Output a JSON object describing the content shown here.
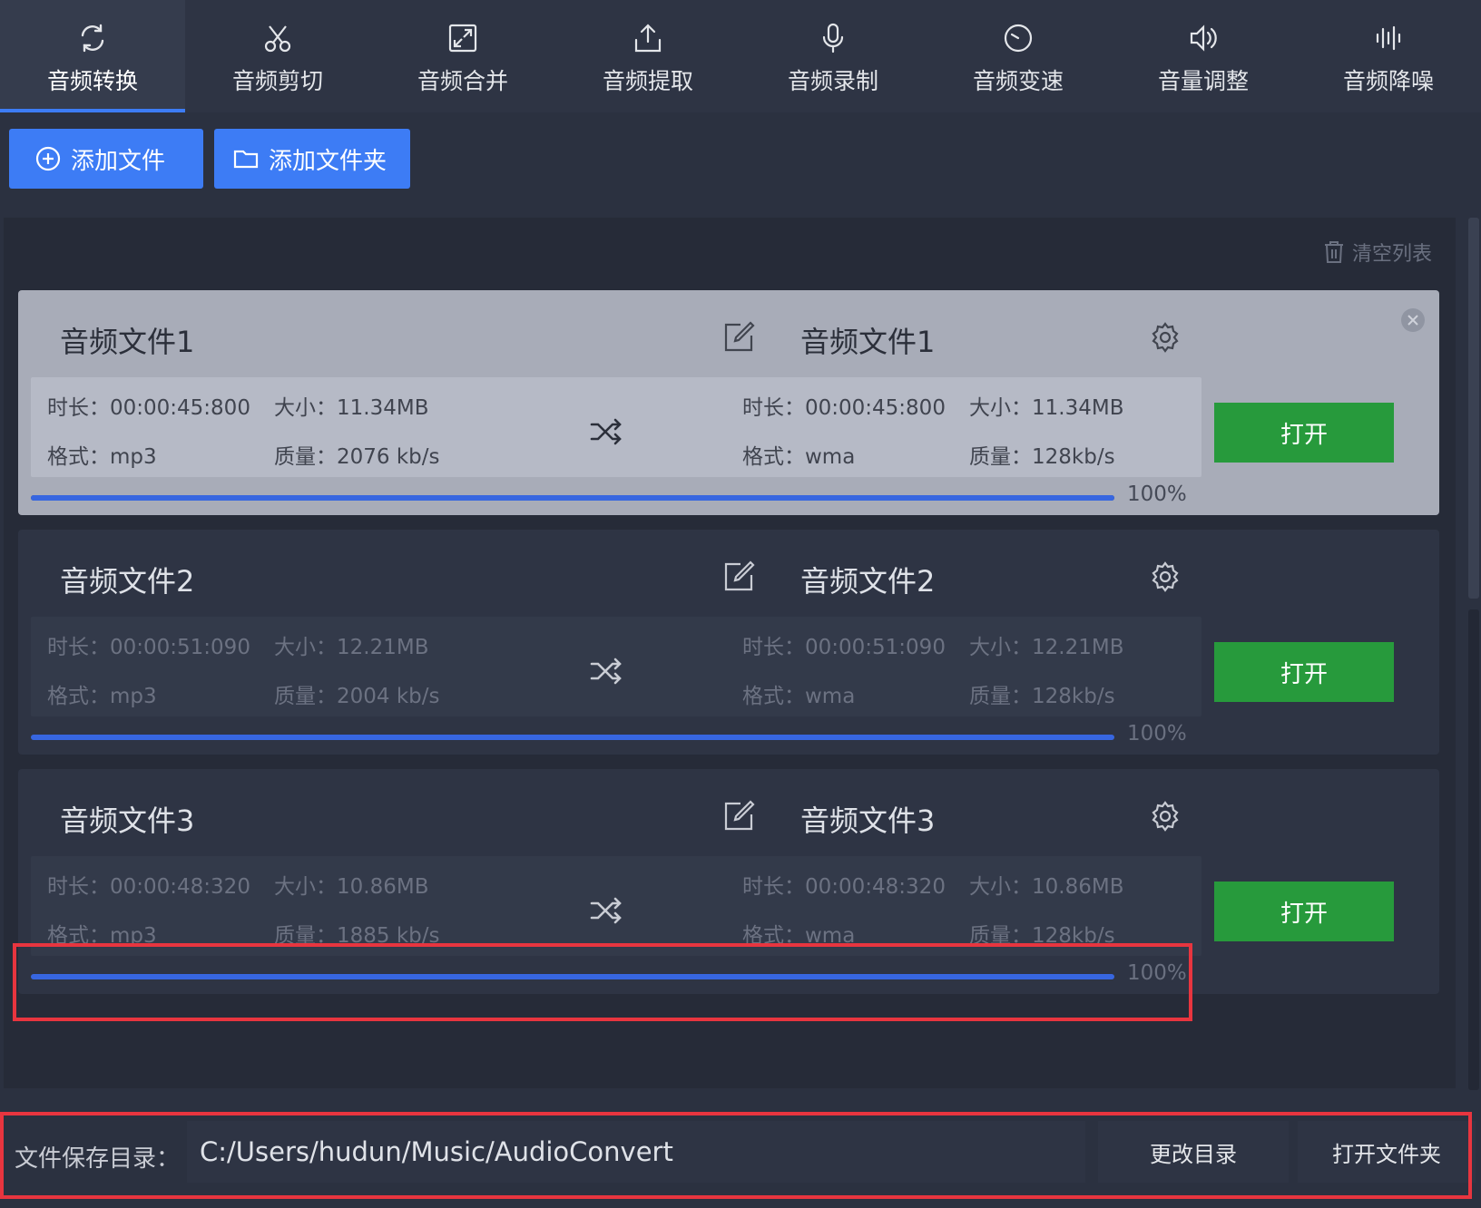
{
  "tabs": [
    {
      "label": "音频转换",
      "icon": "refresh-icon",
      "active": true
    },
    {
      "label": "音频剪切",
      "icon": "scissors-icon",
      "active": false
    },
    {
      "label": "音频合并",
      "icon": "merge-icon",
      "active": false
    },
    {
      "label": "音频提取",
      "icon": "extract-icon",
      "active": false
    },
    {
      "label": "音频录制",
      "icon": "microphone-icon",
      "active": false
    },
    {
      "label": "音频变速",
      "icon": "speed-icon",
      "active": false
    },
    {
      "label": "音量调整",
      "icon": "volume-icon",
      "active": false
    },
    {
      "label": "音频降噪",
      "icon": "waveform-icon",
      "active": false
    }
  ],
  "toolbar": {
    "add_file": "添加文件",
    "add_folder": "添加文件夹"
  },
  "list": {
    "clear_label": "清空列表",
    "open_label": "打开",
    "files": [
      {
        "source_name": "音频文件1",
        "source": {
          "duration": "时长：00:00:45:800",
          "size": "大小：11.34MB",
          "format": "格式：mp3",
          "quality": "质量：2076 kb/s"
        },
        "target_name": "音频文件1",
        "target": {
          "duration": "时长：00:00:45:800",
          "size": "大小：11.34MB",
          "format": "格式：wma",
          "quality": "质量：128kb/s"
        },
        "progress": 100,
        "progress_label": "100%"
      },
      {
        "source_name": "音频文件2",
        "source": {
          "duration": "时长：00:00:51:090",
          "size": "大小：12.21MB",
          "format": "格式：mp3",
          "quality": "质量：2004 kb/s"
        },
        "target_name": "音频文件2",
        "target": {
          "duration": "时长：00:00:51:090",
          "size": "大小：12.21MB",
          "format": "格式：wma",
          "quality": "质量：128kb/s"
        },
        "progress": 100,
        "progress_label": "100%"
      },
      {
        "source_name": "音频文件3",
        "source": {
          "duration": "时长：00:00:48:320",
          "size": "大小：10.86MB",
          "format": "格式：mp3",
          "quality": "质量：1885 kb/s"
        },
        "target_name": "音频文件3",
        "target": {
          "duration": "时长：00:00:48:320",
          "size": "大小：10.86MB",
          "format": "格式：wma",
          "quality": "质量：128kb/s"
        },
        "progress": 100,
        "progress_label": "100%"
      }
    ]
  },
  "footer": {
    "save_dir_label": "文件保存目录：",
    "save_dir_value": "C:/Users/hudun/Music/AudioConvert",
    "change_dir": "更改目录",
    "open_folder": "打开文件夹"
  },
  "colors": {
    "accent": "#3d7cf5",
    "open_button": "#279a3c",
    "annotation": "#e8353f"
  }
}
